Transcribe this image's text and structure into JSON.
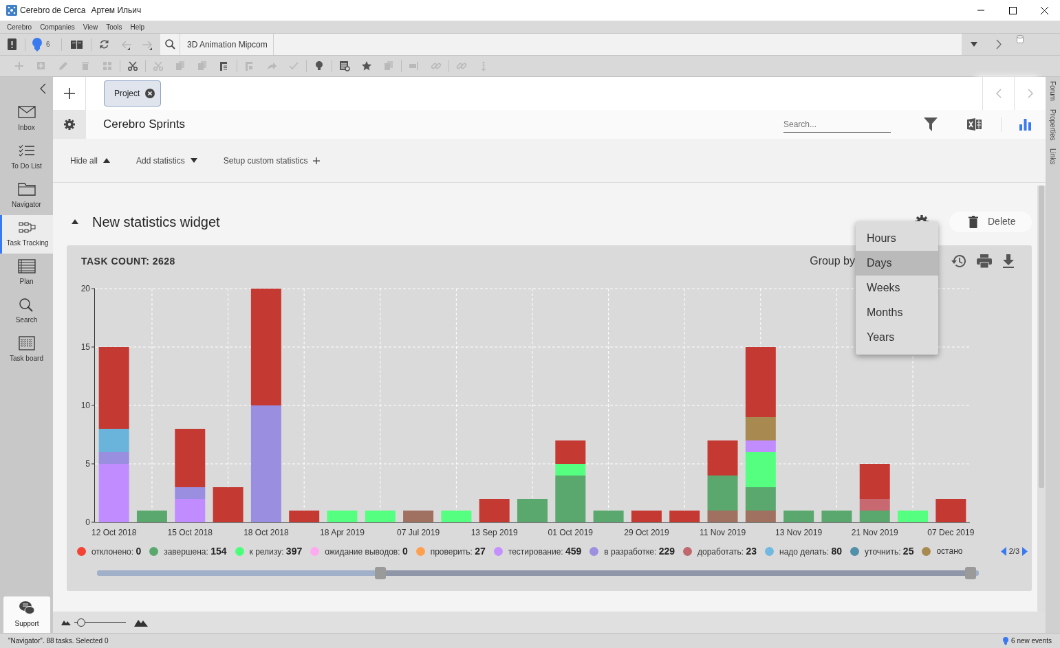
{
  "window": {
    "app": "Cerebro de Cerca",
    "user": "Артем Ильич"
  },
  "menu": [
    "Cerebro",
    "Companies",
    "View",
    "Tools",
    "Help"
  ],
  "toolbar": {
    "notifications": "6",
    "address": "3D Animation Mipcom",
    "back_disabled": true,
    "forward_disabled": true
  },
  "tool_icons": [
    {
      "disabled": true
    },
    {
      "disabled": true
    },
    {
      "disabled": true
    },
    {
      "disabled": true
    },
    {
      "disabled": true
    },
    {
      "disabled": false
    },
    {
      "disabled": true
    },
    {
      "disabled": true
    },
    {
      "disabled": true
    },
    {
      "disabled": false
    },
    {
      "disabled": true
    },
    {
      "disabled": true
    },
    {
      "disabled": true
    },
    {
      "disabled": false
    },
    {
      "disabled": false
    },
    {
      "disabled": false
    },
    {
      "disabled": true
    },
    {
      "disabled": true
    },
    {
      "disabled": true
    },
    {
      "disabled": true
    },
    {
      "disabled": true
    }
  ],
  "sidebar": {
    "items": [
      {
        "label": "Inbox",
        "selected": false
      },
      {
        "label": "To Do List",
        "selected": false
      },
      {
        "label": "Navigator",
        "selected": false
      },
      {
        "label": "Task Tracking",
        "selected": true
      },
      {
        "label": "Plan",
        "selected": false
      },
      {
        "label": "Search",
        "selected": false
      },
      {
        "label": "Task board",
        "selected": false
      }
    ],
    "support": "Support"
  },
  "side_tabs": [
    "Forum",
    "Properties",
    "Links"
  ],
  "tabs": [
    {
      "label": "Project",
      "selected": true
    }
  ],
  "header": {
    "title": "Cerebro Sprints",
    "search": {
      "placeholder": "Search..."
    }
  },
  "stats_toolbar": [
    {
      "label": "Hide all",
      "kind": "collapse"
    },
    {
      "label": "Add statistics",
      "kind": "dropdown"
    },
    {
      "label": "Setup custom statistics",
      "kind": "add"
    }
  ],
  "widget": {
    "title": "New statistics widget",
    "expanded": true,
    "delete": "Delete",
    "total": "TASK COUNT: 2628",
    "group_by": "Group by",
    "group_options": [
      {
        "label": "Hours",
        "selected": false
      },
      {
        "label": "Days",
        "selected": true
      },
      {
        "label": "Weeks",
        "selected": false
      },
      {
        "label": "Months",
        "selected": false
      },
      {
        "label": "Years",
        "selected": false
      }
    ],
    "legend": [
      {
        "text": "отклонено: **0**",
        "color": "#f44336"
      },
      {
        "text": "завершена: **154**",
        "color": "#5aa86e"
      },
      {
        "text": "к релизу: **397**",
        "color": "#4cff7a"
      },
      {
        "text": "ожидание выводов: **0**",
        "color": "#ffaaf0"
      },
      {
        "text": "проверить: **27**",
        "color": "#ffa050"
      },
      {
        "text": "тестирование: **459**",
        "color": "#c590ff"
      },
      {
        "text": "в разработке: **229**",
        "color": "#9c8fe0"
      },
      {
        "text": "доработать: **23**",
        "color": "#c0686e"
      },
      {
        "text": "надо делать: **80**",
        "color": "#72b8e0"
      },
      {
        "text": "уточнить: **25**",
        "color": "#5090a8"
      },
      {
        "text": "остано",
        "color": "#a88a50"
      }
    ],
    "legend_page": "2/3",
    "chart_data": {
      "type": "bar",
      "stacked": true,
      "grid": true,
      "categories": [
        "12 Oct 2018",
        null,
        "15 Oct 2018",
        null,
        "18 Oct 2018",
        null,
        "18 Apr 2019",
        null,
        "07 Jul 2019",
        null,
        "13 Sep 2019",
        null,
        "01 Oct 2019",
        null,
        "29 Oct 2019",
        null,
        "11 Nov 2019",
        null,
        "13 Nov 2019",
        null,
        "21 Nov 2019",
        null,
        "07 Dec 2019"
      ],
      "ylim": [
        0,
        20
      ],
      "yticks": [
        0,
        5,
        10,
        15,
        20
      ],
      "series": [
        {
          "color": "#a07060",
          "values": [
            0,
            0,
            0,
            0,
            0,
            0,
            0,
            0,
            1,
            0,
            0,
            0,
            0,
            0,
            0,
            0,
            1,
            1,
            0,
            0,
            0,
            0,
            0
          ]
        },
        {
          "color": "#5aa86e",
          "values": [
            0,
            1,
            0,
            0,
            0,
            0,
            0,
            0,
            0,
            0,
            0,
            2,
            4,
            1,
            0,
            0,
            3,
            2,
            1,
            1,
            1,
            0,
            0
          ]
        },
        {
          "color": "#55ff80",
          "values": [
            0,
            0,
            0,
            0,
            0,
            0,
            1,
            1,
            0,
            1,
            0,
            0,
            1,
            0,
            0,
            0,
            0,
            3,
            0,
            0,
            0,
            1,
            0
          ]
        },
        {
          "color": "#c08cff",
          "values": [
            5,
            0,
            2,
            0,
            0,
            0,
            0,
            0,
            0,
            0,
            0,
            0,
            0,
            0,
            0,
            0,
            0,
            1,
            0,
            0,
            0,
            0,
            0
          ]
        },
        {
          "color": "#9a8ee0",
          "values": [
            1,
            0,
            1,
            0,
            10,
            0,
            0,
            0,
            0,
            0,
            0,
            0,
            0,
            0,
            0,
            0,
            0,
            0,
            0,
            0,
            0,
            0,
            0
          ]
        },
        {
          "color": "#6ab4dc",
          "values": [
            2,
            0,
            0,
            0,
            0,
            0,
            0,
            0,
            0,
            0,
            0,
            0,
            0,
            0,
            0,
            0,
            0,
            0,
            0,
            0,
            0,
            0,
            0
          ]
        },
        {
          "color": "#c86870",
          "values": [
            0,
            0,
            0,
            0,
            0,
            0,
            0,
            0,
            0,
            0,
            0,
            0,
            0,
            0,
            0,
            0,
            0,
            0,
            0,
            0,
            1,
            0,
            0
          ]
        },
        {
          "color": "#a88a50",
          "values": [
            0,
            0,
            0,
            0,
            0,
            0,
            0,
            0,
            0,
            0,
            0,
            0,
            0,
            0,
            0,
            0,
            0,
            2,
            0,
            0,
            0,
            0,
            0
          ]
        },
        {
          "color": "#c43a33",
          "values": [
            7,
            0,
            5,
            3,
            10,
            1,
            0,
            0,
            0,
            0,
            2,
            0,
            2,
            0,
            1,
            1,
            3,
            6,
            0,
            0,
            3,
            0,
            2
          ]
        }
      ]
    }
  },
  "zoom": {
    "level": 0.13
  },
  "status": {
    "text": "\"Navigator\". 88 tasks. Selected 0",
    "events": "6 new events"
  }
}
